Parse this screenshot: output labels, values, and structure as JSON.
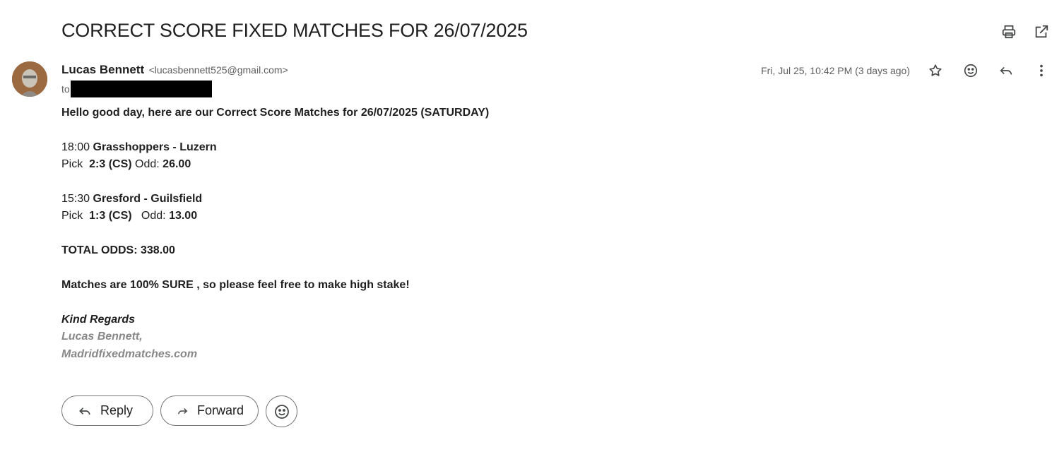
{
  "subject": "CORRECT SCORE FIXED MATCHES FOR 26/07/2025",
  "top_actions": {
    "print_icon": "print-icon",
    "open_new_window_icon": "open-in-new-icon"
  },
  "sender": {
    "name": "Lucas Bennett",
    "email": "<lucasbennett525@gmail.com>",
    "to_label": "to"
  },
  "meta": {
    "date": "Fri, Jul 25, 10:42 PM (3 days ago)",
    "icons": [
      "star-icon",
      "emoji-icon",
      "reply-icon",
      "more-vert-icon"
    ]
  },
  "body": {
    "greeting": "Hello good day, here are our Correct Score Matches for 26/07/2025 (SATURDAY)",
    "matches": [
      {
        "time": "18:00",
        "teams": "Grasshoppers - Luzern",
        "pick_label": "Pick",
        "pick": "2:3 (CS)",
        "odd_label": "Odd:",
        "odd": "26.00"
      },
      {
        "time": "15:30",
        "teams": "Gresford - Guilsfield",
        "pick_label": "Pick",
        "pick": "1:3 (CS)",
        "odd_label": "Odd:",
        "odd": "13.00"
      }
    ],
    "total": "TOTAL ODDS: 338.00",
    "sure": "Matches are 100% SURE , so please feel free to make high stake!",
    "regards": "Kind Regards",
    "sig_name": "Lucas Bennett,",
    "sig_site": "Madridfixedmatches.com"
  },
  "actions": {
    "reply": "Reply",
    "forward": "Forward"
  }
}
